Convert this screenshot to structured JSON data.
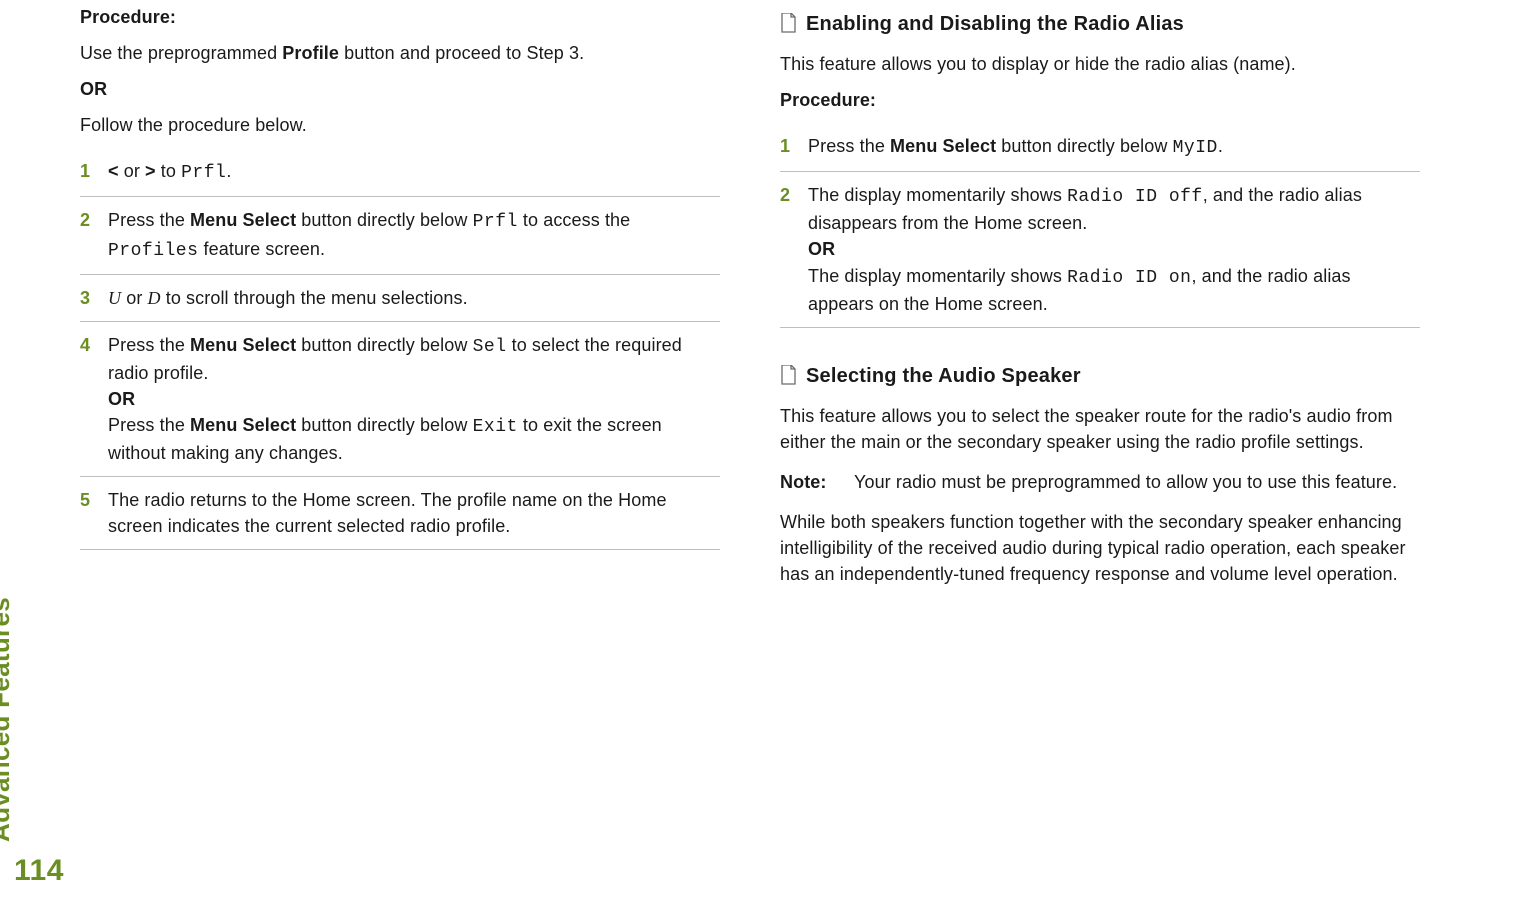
{
  "side_label": "Advanced Features",
  "page_number": "114",
  "left": {
    "procedure_label": "Procedure:",
    "intro_1a": "Use the preprogrammed ",
    "intro_1b": "Profile",
    "intro_1c": " button and proceed to Step 3.",
    "or": "OR",
    "intro_2": "Follow the procedure below.",
    "steps": [
      {
        "n": "1",
        "a": "< ",
        "b": "or",
        "c": " > ",
        "d": "to ",
        "e": "Prfl",
        "f": "."
      },
      {
        "n": "2",
        "a": "Press the ",
        "b": "Menu Select",
        "c": " button directly below ",
        "d": "Prfl",
        "e": " to access the ",
        "f": "Profiles",
        "g": " feature screen."
      },
      {
        "n": "3",
        "a": "U",
        "b": " or ",
        "c": "D",
        "d": " to scroll through the menu selections."
      },
      {
        "n": "4",
        "a": "Press the ",
        "b": "Menu Select",
        "c": " button directly below ",
        "d": "Sel",
        "e": " to select the required radio profile.",
        "or": "OR",
        "f": "Press the ",
        "g": "Menu Select",
        "h": " button directly below ",
        "i": "Exit",
        "j": " to exit the screen without making any changes."
      },
      {
        "n": "5",
        "a": "The radio returns to the Home screen. The profile name on the Home screen indicates the current selected radio profile."
      }
    ]
  },
  "right": {
    "sec1_title": "Enabling and Disabling the Radio Alias",
    "sec1_intro": "This feature allows you to display or hide the radio alias (name).",
    "procedure_label": "Procedure:",
    "sec1_steps": [
      {
        "n": "1",
        "a": "Press the ",
        "b": "Menu Select",
        "c": " button directly below ",
        "d": "MyID",
        "e": "."
      },
      {
        "n": "2",
        "a": "The display momentarily shows ",
        "b": "Radio ID off",
        "c": ", and the radio alias disappears from the Home screen.",
        "or": "OR",
        "d": "The display momentarily shows ",
        "e": "Radio ID on",
        "f": ", and the radio alias appears on the Home screen."
      }
    ],
    "sec2_title": "Selecting the Audio Speaker",
    "sec2_intro": "This feature allows you to select the speaker route for the radio's audio from either the main or the secondary speaker using the radio profile settings.",
    "note_label": "Note:",
    "note_body": "Your radio must be preprogrammed to allow you to use this feature.",
    "sec2_para2": "While both speakers function together with the secondary speaker enhancing intelligibility of the received audio during typical radio operation, each speaker has an independently-tuned frequency response and volume level operation."
  }
}
